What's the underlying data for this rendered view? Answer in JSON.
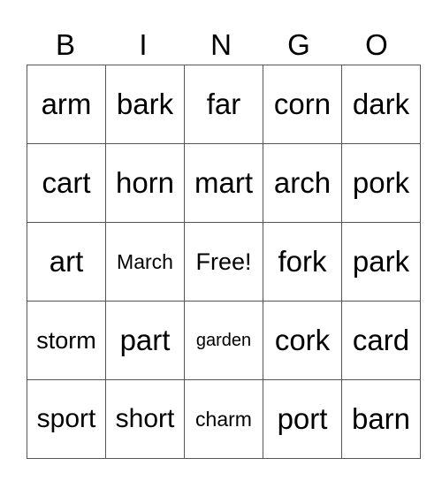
{
  "header": [
    "B",
    "I",
    "N",
    "G",
    "O"
  ],
  "rows": [
    [
      "arm",
      "bark",
      "far",
      "corn",
      "dark"
    ],
    [
      "cart",
      "horn",
      "mart",
      "arch",
      "pork"
    ],
    [
      "art",
      "March",
      "Free!",
      "fork",
      "park"
    ],
    [
      "storm",
      "part",
      "garden",
      "cork",
      "card"
    ],
    [
      "sport",
      "short",
      "charm",
      "port",
      "barn"
    ]
  ]
}
